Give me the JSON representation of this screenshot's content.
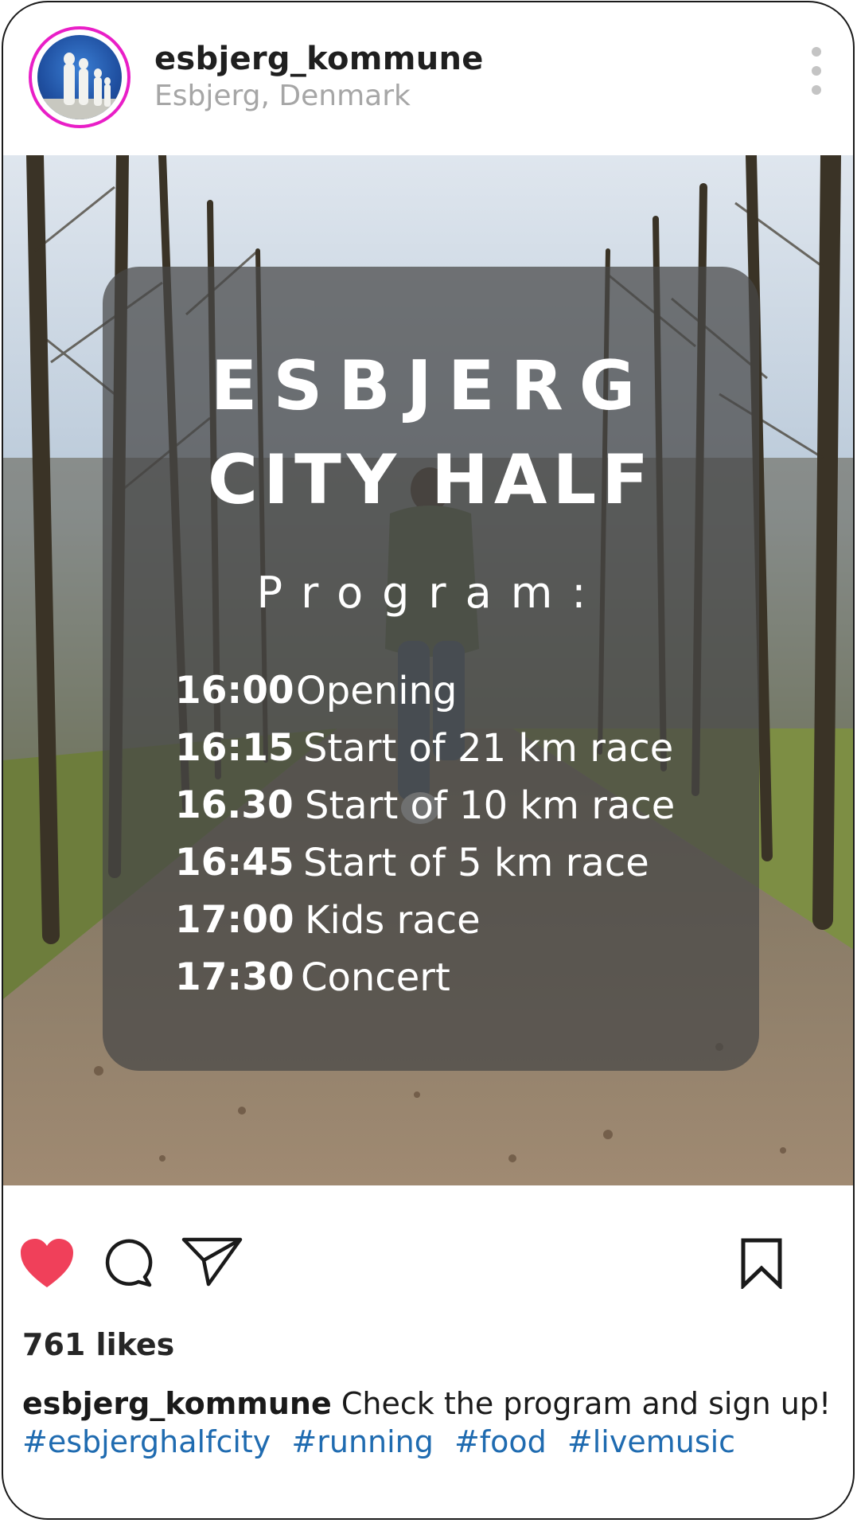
{
  "post": {
    "username": "esbjerg_kommune",
    "location": "Esbjerg, Denmark"
  },
  "image": {
    "title_line1": "ESBJERG",
    "title_line2": "CITY HALF",
    "program_label": "Program:",
    "schedule": [
      {
        "time": "16:00",
        "event": "Opening"
      },
      {
        "time": "16:15",
        "event": "Start of 21 km race"
      },
      {
        "time": "16.30",
        "event": "Start of 10 km race"
      },
      {
        "time": "16:45",
        "event": "Start of 5 km race"
      },
      {
        "time": "17:00",
        "event": "Kids race"
      },
      {
        "time": "17:30",
        "event": "Concert"
      }
    ]
  },
  "actions": {
    "liked": true,
    "like_color": "#f0405a"
  },
  "likes_text": "761 likes",
  "caption": {
    "username": "esbjerg_kommune",
    "text": "Check the program and sign up!",
    "hashtags": [
      "#esbjerghalfcity",
      "#running",
      "#food",
      "#livemusic"
    ]
  },
  "colors": {
    "story_ring": "#e91ec7",
    "hashtag": "#1f6bb0"
  }
}
